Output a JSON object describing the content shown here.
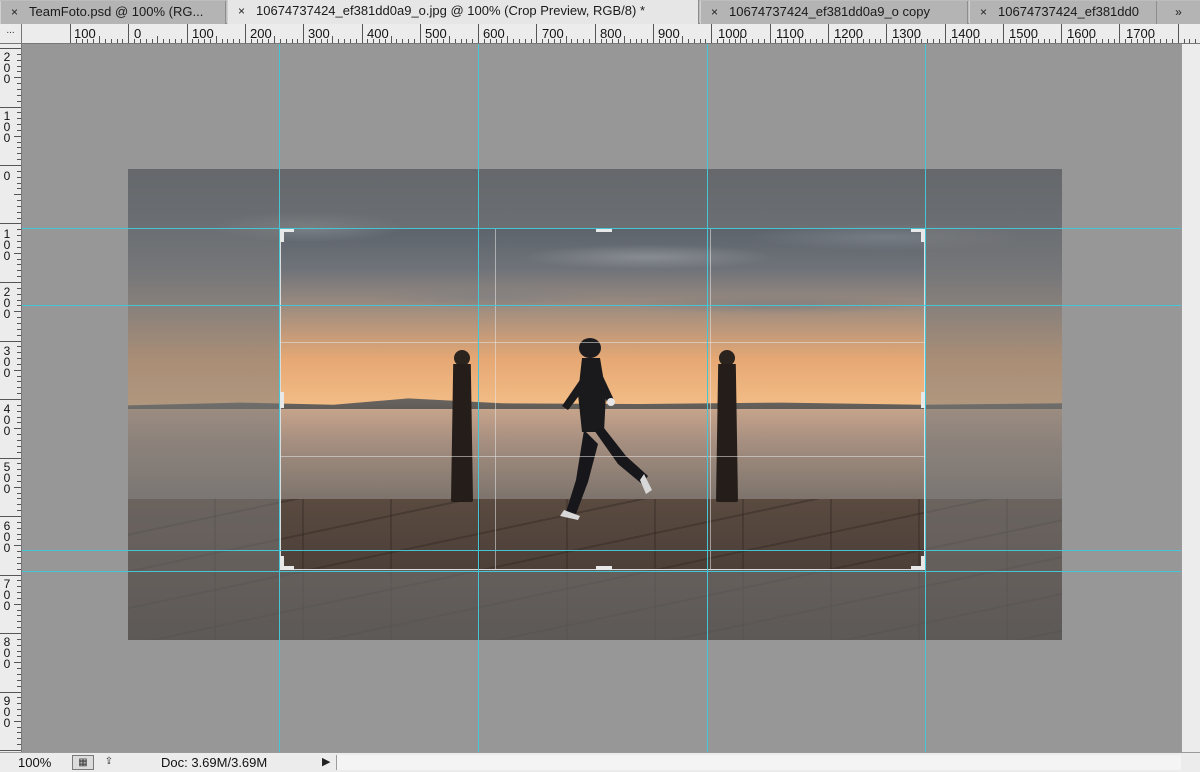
{
  "tabs": [
    {
      "label": "TeamFoto.psd @ 100% (RG...",
      "active": false
    },
    {
      "label": "10674737424_ef381dd0a9_o.jpg @ 100% (Crop Preview, RGB/8) *",
      "active": true
    },
    {
      "label": "10674737424_ef381dd0a9_o copy",
      "active": false
    },
    {
      "label": "10674737424_ef381dd0",
      "active": false
    }
  ],
  "tab_close_glyph": "×",
  "tab_overflow_glyph": "»",
  "ruler_top": {
    "corner_label": "...",
    "labels": [
      "100",
      "0",
      "100",
      "200",
      "300",
      "400",
      "500",
      "600",
      "700",
      "800",
      "900",
      "1000",
      "1100",
      "1200",
      "1300",
      "1400",
      "1500",
      "1600",
      "1700"
    ]
  },
  "ruler_left": {
    "labels": [
      [
        "2",
        "0",
        "0"
      ],
      [
        "1",
        "0",
        "0"
      ],
      [
        "0"
      ],
      [
        "1",
        "0",
        "0"
      ],
      [
        "2",
        "0",
        "0"
      ],
      [
        "3",
        "0",
        "0"
      ],
      [
        "4",
        "0",
        "0"
      ],
      [
        "5",
        "0",
        "0"
      ],
      [
        "6",
        "0",
        "0"
      ],
      [
        "7",
        "0",
        "0"
      ],
      [
        "8",
        "0",
        "0"
      ],
      [
        "9",
        "0",
        "0"
      ]
    ]
  },
  "document": {
    "mode": "Crop Preview",
    "overlay": "rule-of-thirds",
    "guide_color": "#45c6d6"
  },
  "status": {
    "zoom": "100%",
    "doc_size": "Doc: 3.69M/3.69M",
    "icons": [
      "proof-setup-icon",
      "share-icon"
    ],
    "arrow": "▶"
  }
}
